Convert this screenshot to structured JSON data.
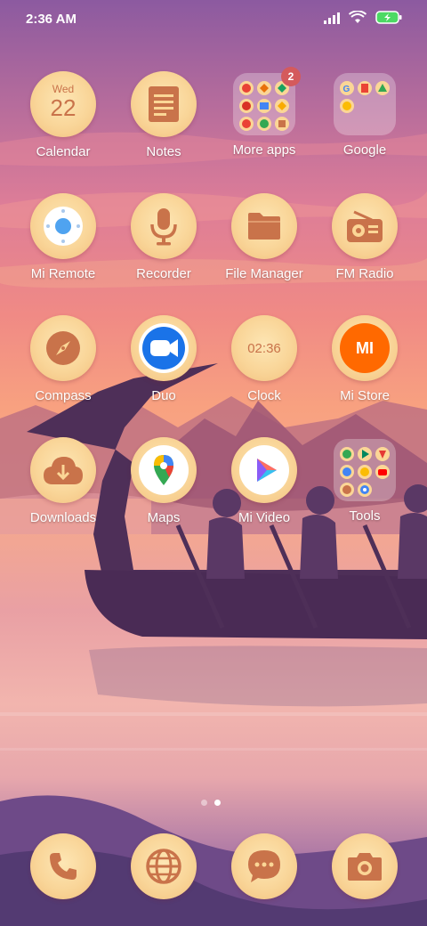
{
  "status_bar": {
    "time": "2:36 AM",
    "icons": [
      "signal-icon",
      "wifi-icon",
      "battery-charging-icon"
    ]
  },
  "apps": [
    {
      "label": "Calendar",
      "icon": "calendar-icon",
      "day": "Wed",
      "date": "22"
    },
    {
      "label": "Notes",
      "icon": "notes-icon"
    },
    {
      "label": "More apps",
      "icon": "folder-icon",
      "badge": "2"
    },
    {
      "label": "Google",
      "icon": "folder-icon"
    },
    {
      "label": "Mi Remote",
      "icon": "remote-icon"
    },
    {
      "label": "Recorder",
      "icon": "microphone-icon"
    },
    {
      "label": "File Manager",
      "icon": "folder-file-icon"
    },
    {
      "label": "FM Radio",
      "icon": "radio-icon"
    },
    {
      "label": "Compass",
      "icon": "compass-icon"
    },
    {
      "label": "Duo",
      "icon": "video-camera-icon"
    },
    {
      "label": "Clock",
      "icon": "clock-icon",
      "time": "02:36"
    },
    {
      "label": "Mi Store",
      "icon": "mi-store-icon",
      "logo_text": "MI"
    },
    {
      "label": "Downloads",
      "icon": "cloud-download-icon"
    },
    {
      "label": "Maps",
      "icon": "maps-pin-icon"
    },
    {
      "label": "Mi Video",
      "icon": "play-icon"
    },
    {
      "label": "Tools",
      "icon": "folder-icon"
    }
  ],
  "page_indicator": {
    "pages": 2,
    "active": 2
  },
  "dock": [
    {
      "name": "Phone",
      "icon": "phone-icon"
    },
    {
      "name": "Browser",
      "icon": "globe-icon"
    },
    {
      "name": "Messages",
      "icon": "message-bubble-icon"
    },
    {
      "name": "Camera",
      "icon": "camera-icon"
    }
  ],
  "colors": {
    "icon_bg": "#f9d598",
    "icon_glyph": "#c9734a",
    "badge": "#d45a5c",
    "mi_orange": "#ff6900",
    "duo_blue": "#1a73e8"
  }
}
